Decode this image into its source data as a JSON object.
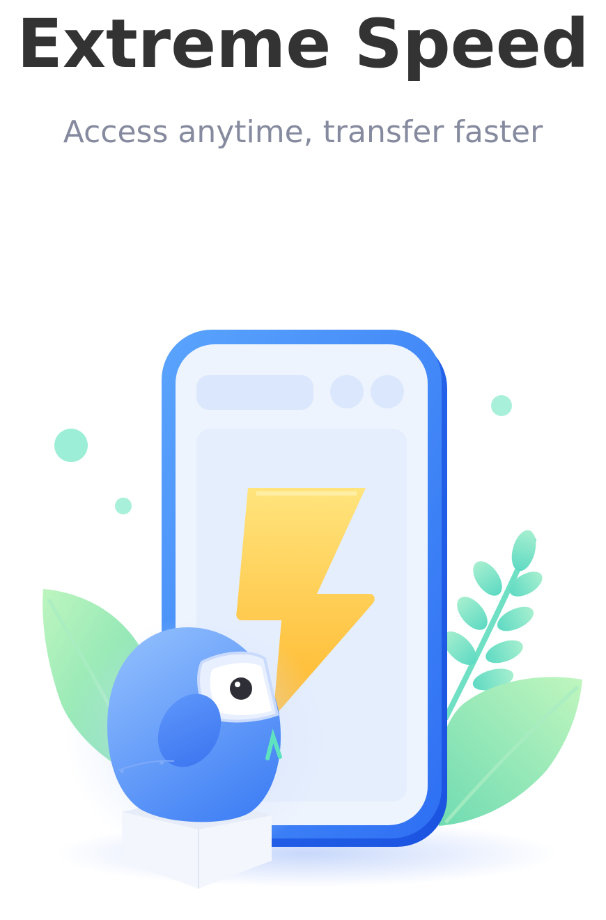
{
  "header": {
    "title": "Extreme Speed",
    "subtitle": "Access anytime, transfer faster"
  },
  "illustration": {
    "icons": [
      "smartphone-icon",
      "lightning-bolt-icon",
      "mascot-icon",
      "leaf-icon",
      "branch-icon"
    ]
  },
  "colors": {
    "title": "#333333",
    "subtitle": "#858a9e",
    "phone_frame": "#4a8df8",
    "bolt": "#ffc94a",
    "mascot": "#5d9bfb",
    "leaf": "#8fe6b4",
    "dot": "#8feace"
  }
}
